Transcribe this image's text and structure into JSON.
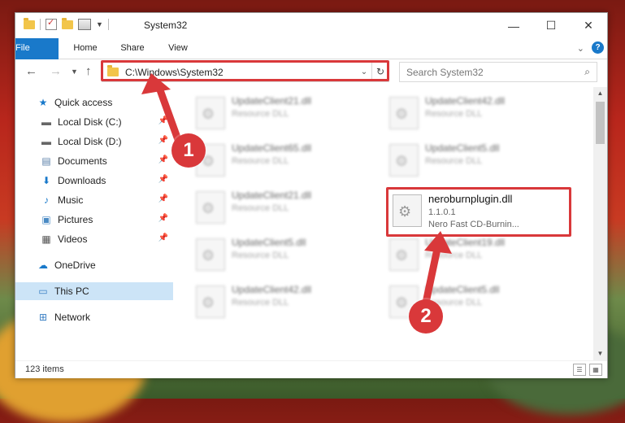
{
  "window": {
    "title": "System32",
    "controls": {
      "minimize": "—",
      "maximize": "☐",
      "close": "✕"
    }
  },
  "ribbon": {
    "tabs": [
      "File",
      "Home",
      "Share",
      "View"
    ],
    "help": "?"
  },
  "nav": {
    "address": "C:\\Windows\\System32",
    "search_placeholder": "Search System32"
  },
  "sidebar": {
    "items": [
      {
        "label": "Quick access",
        "icon": "star-icon"
      },
      {
        "label": "Local Disk (C:)",
        "icon": "drive-icon",
        "pinned": true
      },
      {
        "label": "Local Disk (D:)",
        "icon": "drive-icon",
        "pinned": true
      },
      {
        "label": "Documents",
        "icon": "documents-icon",
        "pinned": true
      },
      {
        "label": "Downloads",
        "icon": "download-icon",
        "pinned": true
      },
      {
        "label": "Music",
        "icon": "music-icon",
        "pinned": true
      },
      {
        "label": "Pictures",
        "icon": "pictures-icon",
        "pinned": true
      },
      {
        "label": "Videos",
        "icon": "videos-icon",
        "pinned": true
      },
      {
        "label": "OneDrive",
        "icon": "cloud-icon"
      },
      {
        "label": "This PC",
        "icon": "computer-icon",
        "selected": true
      },
      {
        "label": "Network",
        "icon": "network-icon"
      }
    ]
  },
  "files": [
    {
      "name": "UpdateClient21.dll",
      "desc": "Resource DLL"
    },
    {
      "name": "UpdateClient42.dll",
      "desc": "Resource DLL"
    },
    {
      "name": "UpdateClient65.dll",
      "desc": "Resource DLL"
    },
    {
      "name": "UpdateClient5.dll",
      "desc": "Resource DLL"
    },
    {
      "name": "UpdateClient21.dll",
      "desc": "Resource DLL"
    },
    {
      "name": "neroburnplugin.dll",
      "version": "1.1.0.1",
      "desc": "Nero Fast CD-Burnin..."
    },
    {
      "name": "UpdateClient5.dll",
      "desc": "Resource DLL"
    },
    {
      "name": "UpdateClient19.dll",
      "desc": "Resource DLL"
    },
    {
      "name": "UpdateClient42.dll",
      "desc": "Resource DLL"
    },
    {
      "name": "UpdateClient5.dll",
      "desc": "Resource DLL"
    }
  ],
  "status": {
    "count": "123 items"
  },
  "annotations": {
    "step1": "1",
    "step2": "2",
    "color": "#d9383a"
  }
}
